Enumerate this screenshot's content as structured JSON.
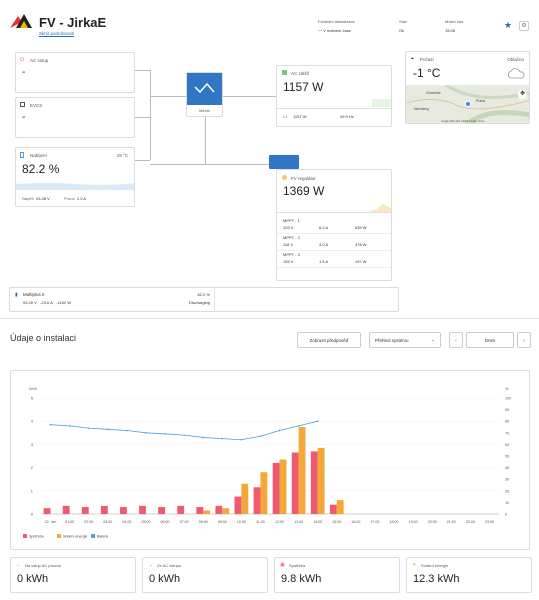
{
  "header": {
    "title": "FV - JirkaE",
    "hide_link": "Skrýt podrobnosti",
    "last_update_label": "Poslední aktualizace",
    "last_update_value": "V reálném čase",
    "state_label": "Stav",
    "state_value": "Ok",
    "local_time_label": "Místní čas",
    "local_time_value": "15:06"
  },
  "ac_input": {
    "label": "AC vstup",
    "value": "-"
  },
  "evcs": {
    "label": "EVCS",
    "value": "-"
  },
  "battery": {
    "label": "Nabíjení",
    "temp": "19 °C",
    "value": "82.2 %",
    "voltage_label": "Napětí",
    "voltage": "53.28 V",
    "current_label": "Proud",
    "current": "2.0 A",
    "level": 0.822
  },
  "inverter": {
    "label": "Měnič"
  },
  "ac_loads": {
    "label": "AC zátěž",
    "value": "1157 W",
    "phase": "L1",
    "power": "1157 W",
    "freq": "49.9 Hz"
  },
  "weather": {
    "label": "Počasí",
    "source": "Oblačno",
    "temp": "-1 °C",
    "map_city1": "Chemnitz",
    "map_city2": "Praha",
    "map_city3": "Nürnberg",
    "map_footer": "Google  Map data ©2025 Google  Terms"
  },
  "pv": {
    "label": "FV regulátor",
    "value": "1369 W",
    "trackers": [
      {
        "name": "MPPT - 1",
        "v": "103 V",
        "a": "6.2 A",
        "w": "639 W"
      },
      {
        "name": "MPPT - 2",
        "v": "118 V",
        "a": "4.0 A",
        "w": "478 W"
      },
      {
        "name": "MPPT - 3",
        "v": "155 V",
        "a": "1.5 A",
        "w": "197 W"
      }
    ]
  },
  "multiplus": {
    "name": "Multiplus II",
    "v": "53.26 V",
    "a": "-23.6 A",
    "w": "-1162 W",
    "pct": "82.0 %",
    "status": "Discharging"
  },
  "install": {
    "title": "Údaje o instalaci",
    "predict_btn": "Zobrazit předpověď",
    "select": "Přehled systému",
    "today_btn": "Dnes"
  },
  "chart_data": {
    "type": "bar",
    "categories": [
      "22. Jan",
      "01:00",
      "02:00",
      "03:00",
      "04:00",
      "05:00",
      "06:00",
      "07:00",
      "08:00",
      "09:00",
      "10:00",
      "11:00",
      "12:00",
      "13:00",
      "14:00",
      "15:00",
      "16:00",
      "17:00",
      "18:00",
      "19:00",
      "20:00",
      "21:00",
      "22:00",
      "23:00"
    ],
    "series": [
      {
        "name": "Spotřeba",
        "color": "#ef5a6f",
        "values": [
          0.25,
          0.35,
          0.3,
          0.35,
          0.3,
          0.35,
          0.3,
          0.35,
          0.3,
          0.35,
          0.75,
          1.15,
          2.2,
          2.65,
          2.7,
          0.4,
          0,
          0,
          0,
          0,
          0,
          0,
          0,
          0
        ]
      },
      {
        "name": "Solární energie",
        "color": "#f5a83a",
        "values": [
          0,
          0,
          0,
          0,
          0,
          0,
          0,
          0,
          0.15,
          0.25,
          1.3,
          1.8,
          2.35,
          3.75,
          2.85,
          0.6,
          0,
          0,
          0,
          0,
          0,
          0,
          0,
          0
        ]
      },
      {
        "name": "Baterie",
        "color": "#4f9fd6",
        "line": [
          77,
          76,
          74,
          73,
          72,
          70,
          69,
          68,
          66,
          65,
          64,
          67,
          72,
          76,
          80,
          null,
          null,
          null,
          null,
          null,
          null,
          null,
          null,
          null
        ]
      }
    ],
    "y_left": {
      "min": 0,
      "max": 5,
      "ticks": [
        "0",
        "1",
        "2",
        "3",
        "4",
        "5"
      ],
      "unit": "kWh"
    },
    "y_right": {
      "min": 0,
      "max": 100,
      "ticks": [
        "0",
        "10",
        "20",
        "30",
        "40",
        "50",
        "60",
        "70",
        "80",
        "90",
        "100"
      ],
      "unit": "%"
    },
    "legend": "bottom-left"
  },
  "totals": [
    {
      "label": "Na vstup AC proudu",
      "value": "0 kWh",
      "color": "#e74c3c",
      "icon": "arrow-left-icon"
    },
    {
      "label": "Ze AC vstupu",
      "value": "0 kWh",
      "color": "#e74c3c",
      "icon": "arrow-right-icon"
    },
    {
      "label": "Spotřeba",
      "value": "9.8 kWh",
      "color": "#ef5a6f",
      "icon": "consumption-icon"
    },
    {
      "label": "Solární energie",
      "value": "12.3 kWh",
      "color": "#f5a83a",
      "icon": "sun-icon"
    }
  ]
}
